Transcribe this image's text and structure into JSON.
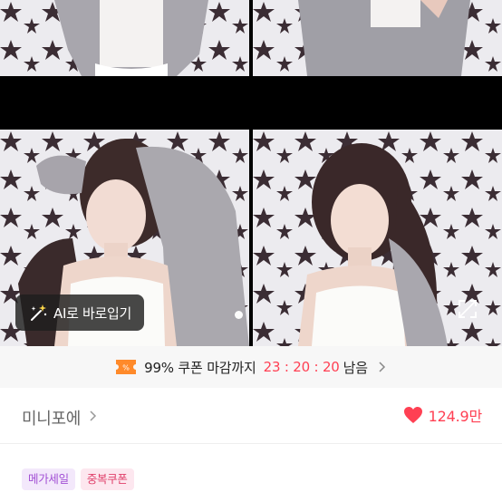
{
  "gallery": {
    "ai_button_label": "AI로 바로입기",
    "photo_count_indicator": "1"
  },
  "coupon": {
    "text": "99% 쿠폰 마감까지",
    "timer": "23 : 20 : 20",
    "suffix": "남음"
  },
  "store": {
    "name": "미니포에",
    "likes": "124.9만"
  },
  "badges": [
    "메가세일",
    "중복쿠폰"
  ],
  "colors": {
    "accent": "#ff4053",
    "coupon_icon": "#ff8a2a",
    "badge_purple": "#a14fd4",
    "badge_pink": "#e0406b"
  },
  "icons": [
    "magic-wand-icon",
    "expand-icon",
    "coupon-icon",
    "chevron-right-icon",
    "heart-icon"
  ]
}
